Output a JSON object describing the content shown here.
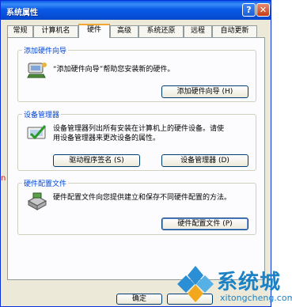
{
  "window": {
    "title": "系统属性"
  },
  "tabs": [
    {
      "label": "常规"
    },
    {
      "label": "计算机名"
    },
    {
      "label": "硬件"
    },
    {
      "label": "高级"
    },
    {
      "label": "系统还原"
    },
    {
      "label": "远程"
    },
    {
      "label": "自动更新"
    }
  ],
  "active_tab": "硬件",
  "add_hardware": {
    "title": "添加硬件向导",
    "description": "“添加硬件向导”帮助您安装新的硬件。",
    "button": "添加硬件向导 (H)"
  },
  "device_manager": {
    "title": "设备管理器",
    "description_line1": "设备管理器列出所有安装在计算机上的硬件设备。请使",
    "description_line2": "用设备管理器来更改设备的属性。",
    "driver_signing_button": "驱动程序签名 (S)",
    "device_manager_button": "设备管理器 (D)"
  },
  "hardware_profiles": {
    "title": "硬件配置文件",
    "description": "硬件配置文件向您提供建立和保存不同硬件配置的方法。",
    "button": "硬件配置文件 (P)"
  },
  "footer": {
    "ok_label": "确定"
  },
  "side_mark": "n",
  "watermark": {
    "brand": "系统城",
    "url": "xitongcheng.com"
  },
  "colors": {
    "titlebar": "#0a5ae8",
    "group_title": "#0046d5",
    "watermark": "#1c82c6"
  }
}
